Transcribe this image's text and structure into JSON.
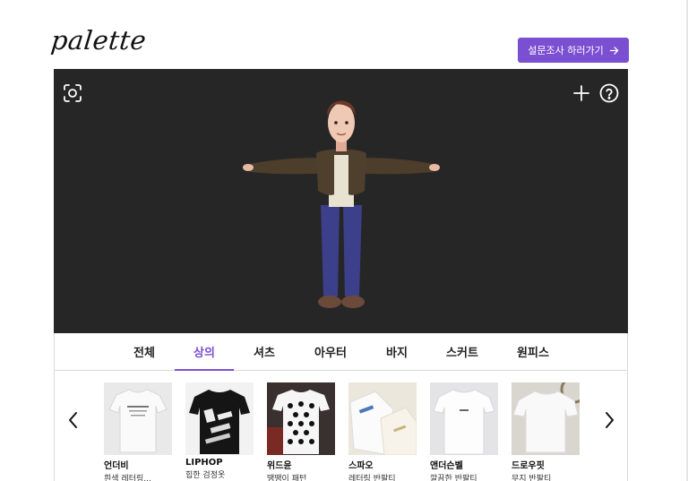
{
  "header": {
    "logo": "palette",
    "survey_button_label": "설문조사 하러가기"
  },
  "viewer": {
    "left_icon": "capture-icon",
    "right_icons": [
      "plus-icon",
      "help-icon"
    ]
  },
  "tabs": [
    {
      "label": "전체",
      "active": false
    },
    {
      "label": "상의",
      "active": true
    },
    {
      "label": "셔츠",
      "active": false
    },
    {
      "label": "아우터",
      "active": false
    },
    {
      "label": "바지",
      "active": false
    },
    {
      "label": "스커트",
      "active": false
    },
    {
      "label": "원피스",
      "active": false
    }
  ],
  "products": [
    {
      "brand": "언더비",
      "desc": "흰색 레터링..."
    },
    {
      "brand": "LIPHOP",
      "desc": "힙한 검정옷"
    },
    {
      "brand": "위드윤",
      "desc": "땡땡이 패턴"
    },
    {
      "brand": "스파오",
      "desc": "레터링 반팔티"
    },
    {
      "brand": "앤더슨벨",
      "desc": "깔끔한 반팔티"
    },
    {
      "brand": "드로우핏",
      "desc": "무지 반팔티"
    }
  ],
  "colors": {
    "accent": "#7b4fd1",
    "viewer_bg": "#262626"
  }
}
